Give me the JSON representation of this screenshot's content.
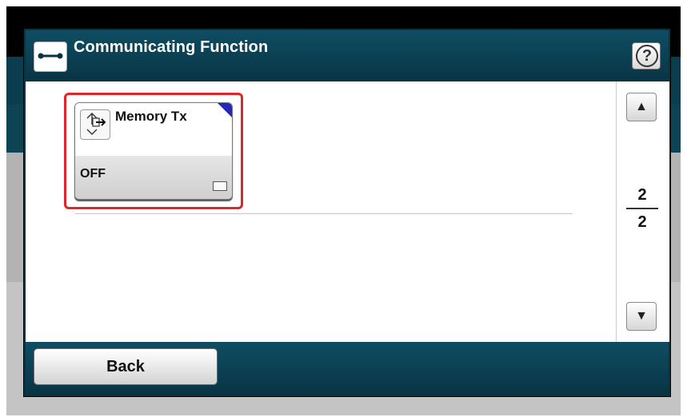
{
  "header": {
    "title": "Communicating Function",
    "icon": "fax-line-icon",
    "help_icon": "help-icon",
    "help_label": "?"
  },
  "setting": {
    "name": "Memory Tx",
    "value": "OFF",
    "icon": "memory-transmit-icon"
  },
  "pager": {
    "current": "2",
    "total": "2",
    "up_label": "▲",
    "down_label": "▼"
  },
  "footer": {
    "back_label": "Back"
  },
  "colors": {
    "header_bg": "#0b3f52",
    "highlight": "#e0252b",
    "corner_marker": "#2428b8"
  }
}
